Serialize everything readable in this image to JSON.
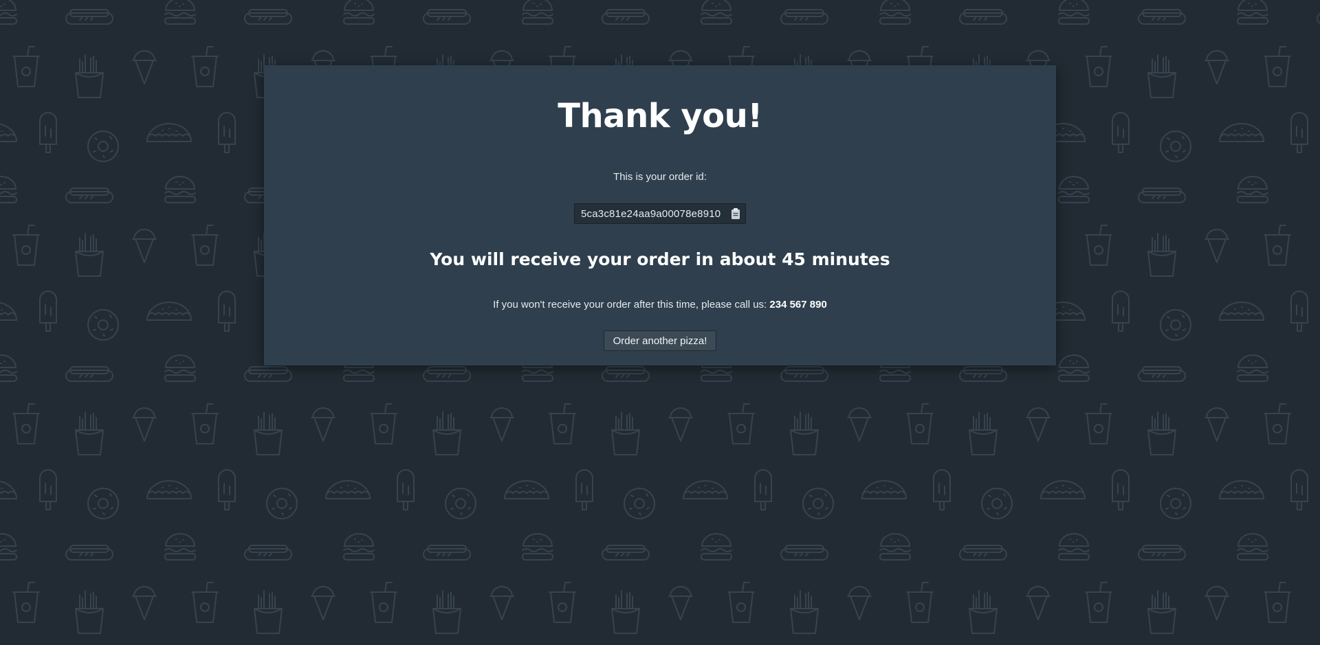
{
  "page": {
    "title": "Thank you!",
    "order_id_label": "This is your order id:",
    "order_id": "5ca3c81e24aa9a00078e8910",
    "eta_text": "You will receive your order in about 45 minutes",
    "callus_text": "If you won't receive your order after this time, please call us:",
    "phone_number": "234 567 890",
    "order_again_label": "Order another pizza!"
  },
  "icons": {
    "copy": "clipboard-icon",
    "background": [
      "hotdog-icon",
      "burger-icon",
      "soda-cup-icon",
      "fries-icon",
      "ice-cream-cone-icon",
      "popsicle-icon",
      "donut-icon",
      "taco-icon"
    ]
  },
  "colors": {
    "background": "#222b33",
    "card": "#2f3f4d",
    "pattern_stroke": "#37434e",
    "text": "#ffffff"
  }
}
